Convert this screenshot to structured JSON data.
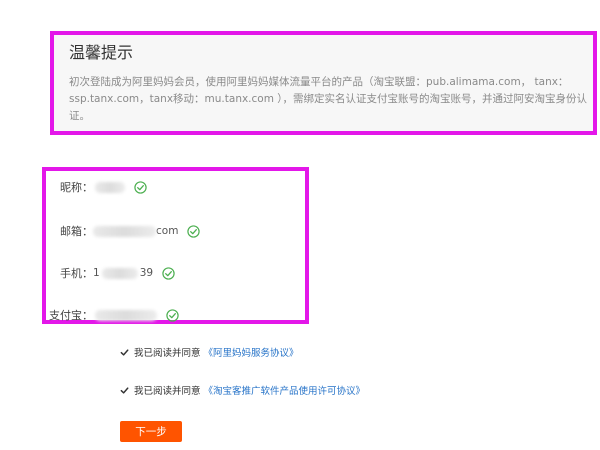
{
  "tip": {
    "title": "温馨提示",
    "body": "初次登陆成为阿里妈妈会员，使用阿里妈妈媒体流量平台的产品（淘宝联盟：pub.alimama.com， tanx：ssp.tanx.com，tanx移动：mu.tanx.com ），需绑定实名认证支付宝账号的淘宝账号，并通过阿安淘宝身份认证。"
  },
  "account": {
    "nickname": {
      "label": "昵称：",
      "value_visible": "",
      "icon": "check-circle-icon"
    },
    "email": {
      "label": "邮箱：",
      "value_visible": "com",
      "icon": "check-circle-icon"
    },
    "phone": {
      "label": "手机：",
      "value_prefix": "1",
      "value_suffix": "39",
      "icon": "check-circle-icon"
    },
    "alipay": {
      "label": "支付宝：",
      "value_visible": "",
      "icon": "check-circle-icon"
    }
  },
  "agreements": [
    {
      "text": "我已阅读并同意",
      "link": "《阿里妈妈服务协议》"
    },
    {
      "text": "我已阅读并同意",
      "link": "《淘宝客推广软件产品使用许可协议》"
    }
  ],
  "next_button": "下一步",
  "colors": {
    "highlight_border": "#e317e9",
    "check_green": "#4caf50",
    "link_blue": "#2673c8",
    "button_orange": "#ff5400"
  }
}
